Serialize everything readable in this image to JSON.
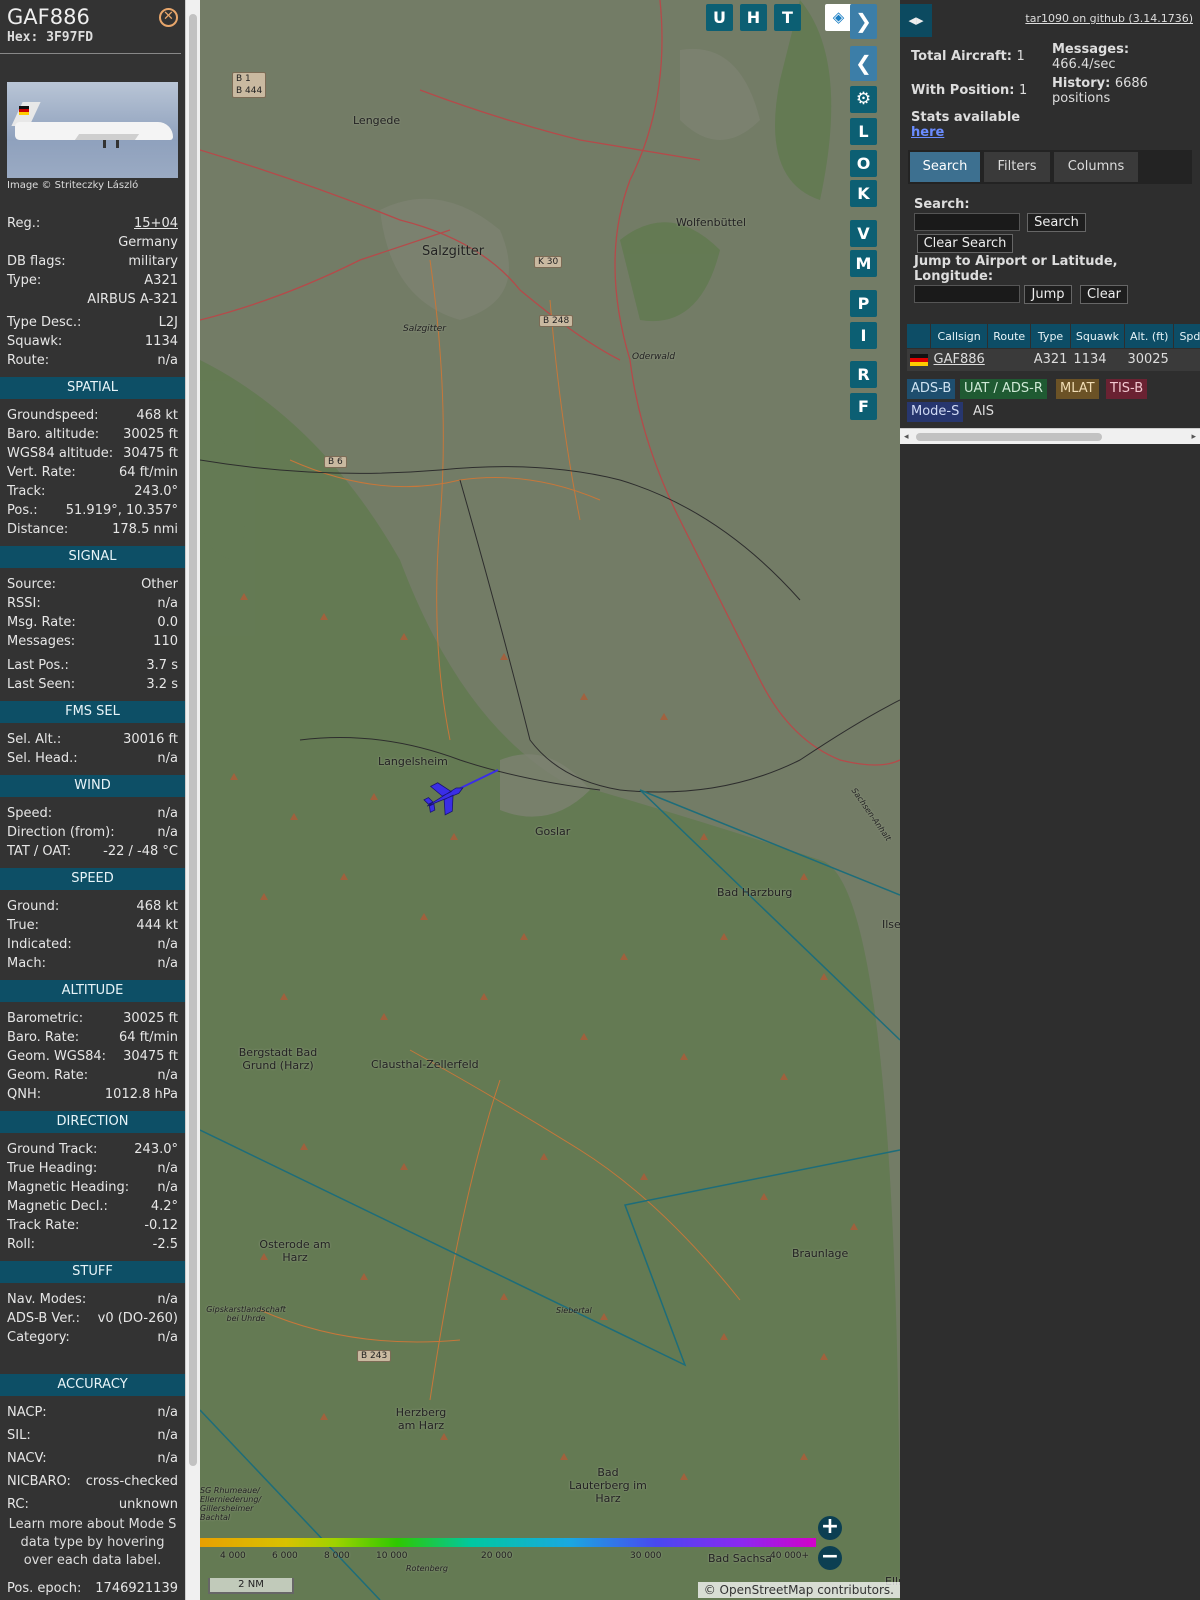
{
  "aircraft": {
    "callsign": "GAF886",
    "hex": "Hex: 3F97FD",
    "image_credit": "Image © Striteczky László"
  },
  "basic": [
    {
      "k": "Reg.:",
      "v": "15+04"
    },
    {
      "k": "",
      "v": "Germany"
    },
    {
      "k": "DB flags:",
      "v": "military"
    },
    {
      "k": "Type:",
      "v": "A321"
    },
    {
      "k": "",
      "v": "AIRBUS A-321"
    },
    {
      "k": "Type Desc.:",
      "v": "L2J"
    },
    {
      "k": "Squawk:",
      "v": "1134"
    },
    {
      "k": "Route:",
      "v": "n/a"
    }
  ],
  "sections": {
    "spatial": "SPATIAL",
    "signal": "SIGNAL",
    "fms": "FMS SEL",
    "wind": "WIND",
    "speed": "SPEED",
    "altitude": "ALTITUDE",
    "direction": "DIRECTION",
    "stuff": "STUFF",
    "accuracy": "ACCURACY"
  },
  "spatial": [
    {
      "k": "Groundspeed:",
      "v": "468 kt"
    },
    {
      "k": "Baro. altitude:",
      "v": "30025 ft"
    },
    {
      "k": "WGS84 altitude:",
      "v": "30475 ft"
    },
    {
      "k": "Vert. Rate:",
      "v": "64 ft/min"
    },
    {
      "k": "Track:",
      "v": "243.0°"
    },
    {
      "k": "Pos.:",
      "v": "51.919°, 10.357°"
    },
    {
      "k": "Distance:",
      "v": "178.5 nmi"
    }
  ],
  "signal": [
    {
      "k": "Source:",
      "v": "Other"
    },
    {
      "k": "RSSI:",
      "v": "n/a"
    },
    {
      "k": "Msg. Rate:",
      "v": "0.0"
    },
    {
      "k": "Messages:",
      "v": "110"
    },
    {
      "k": "Last Pos.:",
      "v": "3.7 s"
    },
    {
      "k": "Last Seen:",
      "v": "3.2 s"
    }
  ],
  "fms": [
    {
      "k": "Sel. Alt.:",
      "v": "30016 ft"
    },
    {
      "k": "Sel. Head.:",
      "v": "n/a"
    }
  ],
  "wind": [
    {
      "k": "Speed:",
      "v": "n/a"
    },
    {
      "k": "Direction (from):",
      "v": "n/a"
    },
    {
      "k": "TAT / OAT:",
      "v": "-22 / -48 °C"
    }
  ],
  "speed": [
    {
      "k": "Ground:",
      "v": "468 kt"
    },
    {
      "k": "True:",
      "v": "444 kt"
    },
    {
      "k": "Indicated:",
      "v": "n/a"
    },
    {
      "k": "Mach:",
      "v": "n/a"
    }
  ],
  "altitude": [
    {
      "k": "Barometric:",
      "v": "30025 ft"
    },
    {
      "k": "Baro. Rate:",
      "v": "64 ft/min"
    },
    {
      "k": "Geom. WGS84:",
      "v": "30475 ft"
    },
    {
      "k": "Geom. Rate:",
      "v": "n/a"
    },
    {
      "k": "QNH:",
      "v": "1012.8 hPa"
    }
  ],
  "direction": [
    {
      "k": "Ground Track:",
      "v": "243.0°"
    },
    {
      "k": "True Heading:",
      "v": "n/a"
    },
    {
      "k": "Magnetic Heading:",
      "v": "n/a"
    },
    {
      "k": "Magnetic Decl.:",
      "v": "4.2°"
    },
    {
      "k": "Track Rate:",
      "v": "-0.12"
    },
    {
      "k": "Roll:",
      "v": "-2.5"
    }
  ],
  "stuff": [
    {
      "k": "Nav. Modes:",
      "v": "n/a"
    },
    {
      "k": "ADS-B Ver.:",
      "v": "v0 (DO-260)"
    },
    {
      "k": "Category:",
      "v": "n/a"
    }
  ],
  "accuracy": [
    {
      "k": "NACP:",
      "v": "n/a"
    },
    {
      "k": "SIL:",
      "v": "n/a"
    },
    {
      "k": "NACV:",
      "v": "n/a"
    },
    {
      "k": "NICBARO:",
      "v": "cross-checked"
    },
    {
      "k": "RC:",
      "v": "unknown"
    }
  ],
  "note": "Learn more about Mode S data type by hovering over each data label.",
  "epoch": {
    "k": "Pos. epoch:",
    "v": "1746921139"
  },
  "map_buttons": {
    "u": "U",
    "h": "H",
    "t": "T",
    "l": "L",
    "o": "O",
    "k": "K",
    "v": "V",
    "m": "M",
    "p": "P",
    "i": "I",
    "r": "R",
    "f": "F"
  },
  "places": {
    "lengede": "Lengede",
    "salzgitter": "Salzgitter",
    "salzgitter_small": "Salzgitter",
    "wolfenbuettel": "Wolfenbüttel",
    "oderwald": "Oderwald",
    "langelsheim": "Langelsheim",
    "goslar": "Goslar",
    "bad_harzburg": "Bad Harzburg",
    "ilse": "Ilse",
    "bergstadt": "Bergstadt Bad Grund (Harz)",
    "clausthal": "Clausthal-Zellerfeld",
    "osterode": "Osterode am Harz",
    "braunlage": "Braunlage",
    "giptkarst": "Gipskarstlandschaft bei Uhrde",
    "sieberta": "Siebertal",
    "herzberg": "Herzberg am Harz",
    "lauterberg": "Bad Lauterberg im Harz",
    "rhumeaue": "SG Rhumeaue/ Ellerniederung/ Gillersheimer Bachtal",
    "rotenberg": "Rotenberg",
    "bad_sachsa": "Bad Sachsa",
    "sachsen": "Sachsen-Anhalt",
    "ellr": "Ellr"
  },
  "roads": {
    "b1": "B 1\nB 444",
    "k30": "K 30",
    "b248": "B 248",
    "b6": "B 6",
    "b243": "B 243"
  },
  "alt_scale": [
    "4 000",
    "6 000",
    "8 000",
    "10 000",
    "20 000",
    "30 000",
    "40 000+"
  ],
  "scale_label": "2 NM",
  "attribution": "© OpenStreetMap contributors.",
  "sidebar": {
    "toggle": "◂▸",
    "github": "tar1090 on github (3.14.1736)",
    "total_aircraft_label": "Total Aircraft:",
    "total_aircraft": "1",
    "with_position_label": "With Position:",
    "with_position": "1",
    "messages_label": "Messages:",
    "messages": "466.4/sec",
    "history_label": "History:",
    "history": "6686 positions",
    "stats_label": "Stats available",
    "stats_link": "here",
    "tabs": [
      "Search",
      "Filters",
      "Columns"
    ],
    "search_label": "Search:",
    "search_button": "Search",
    "clear_search": "Clear Search",
    "jump_label": "Jump to Airport or Latitude, Longitude:",
    "jump_button": "Jump",
    "clear_button": "Clear",
    "columns": [
      "",
      "Callsign",
      "Route",
      "Type",
      "Squawk",
      "Alt. (ft)",
      "Spd."
    ],
    "rows": [
      [
        "",
        "GAF886",
        "",
        "A321",
        "1134",
        "30025",
        ""
      ]
    ],
    "sources": [
      "ADS-B",
      "UAT / ADS-R",
      "MLAT",
      "TIS-B",
      "Mode-S",
      "AIS"
    ]
  }
}
